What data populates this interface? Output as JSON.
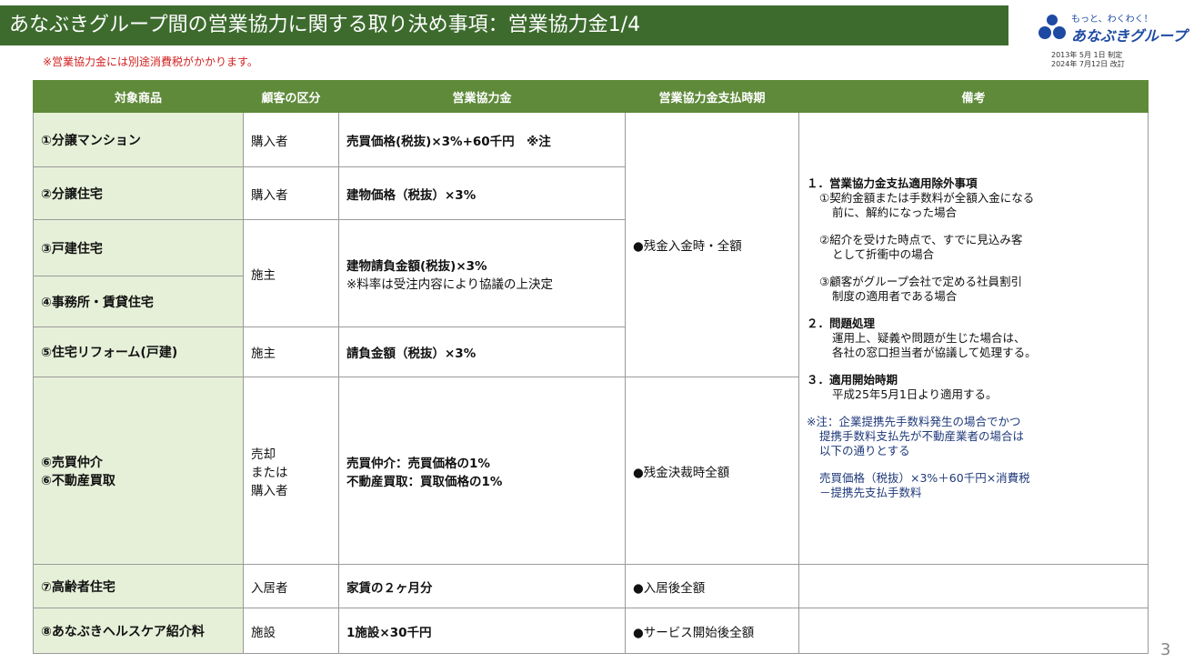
{
  "title": "あなぶきグループ間の営業協力に関する取り決め事項：営業協力金1/4",
  "tax_note": "※営業協力金には別途消費税がかかります。",
  "logo": {
    "tagline": "もっと、わくわく！",
    "name": "あなぶきグループ"
  },
  "dates": {
    "established": "2013年 5月 1日 制定",
    "revised": "2024年 7月12日 改訂"
  },
  "page_number": "3",
  "headers": {
    "product": "対象商品",
    "customer": "顧客の区分",
    "fee": "営業協力金",
    "timing": "営業協力金支払時期",
    "remarks": "備考"
  },
  "rows": {
    "r1": {
      "product": "①分譲マンション",
      "customer": "購入者",
      "fee": "売買価格(税抜)×3%+60千円　※注"
    },
    "r2": {
      "product": "②分譲住宅",
      "customer": "購入者",
      "fee": "建物価格（税抜）×3%"
    },
    "r3": {
      "product": "③戸建住宅"
    },
    "r4": {
      "product": "④事務所・賃貸住宅"
    },
    "r34": {
      "customer": "施主",
      "fee": "建物請負金額(税抜)×3%",
      "fee_note": "※料率は受注内容により協議の上決定"
    },
    "r5": {
      "product": "⑤住宅リフォーム(戸建)",
      "customer": "施主",
      "fee": "請負金額（税抜）×3%"
    },
    "r6": {
      "product_a": "⑥売買仲介",
      "product_b": "⑥不動産買取",
      "customer_a": "売却",
      "customer_b": "または",
      "customer_c": "購入者",
      "fee_a": "売買仲介：売買価格の1%",
      "fee_b": "不動産買取：買取価格の1%",
      "timing": "●残金決裁時全額"
    },
    "r7": {
      "product": "⑦高齢者住宅",
      "customer": "入居者",
      "fee": "家賃の２ヶ月分",
      "timing": "●入居後全額"
    },
    "r8": {
      "product": "⑧あなぶきヘルスケア紹介料",
      "customer": "施設",
      "fee": "1施設×30千円",
      "timing": "●サービス開始後全額"
    },
    "timing_top": "●残金入金時・全額"
  },
  "remarks": {
    "h1": "１．営業協力金支払適用除外事項",
    "i1a": "①契約金額または手数料が全額入金になる",
    "i1b": "前に、解約になった場合",
    "i2a": "②紹介を受けた時点で、すでに見込み客",
    "i2b": "として折衝中の場合",
    "i3a": "③顧客がグループ会社で定める社員割引",
    "i3b": "制度の適用者である場合",
    "h2": "２．問題処理",
    "p2a": "運用上、疑義や問題が生じた場合は、",
    "p2b": "各社の窓口担当者が協議して処理する。",
    "h3": "３．適用開始時期",
    "p3": "平成25年5月1日より適用する。",
    "n1": "※注：企業提携先手数料発生の場合でかつ",
    "n2": "提携手数料支払先が不動産業者の場合は",
    "n3": "以下の通りとする",
    "f1": "売買価格（税抜）×3%＋60千円×消費税",
    "f2": "－提携先支払手数料"
  },
  "colors": {
    "title_bg": "#3d6b2e",
    "header_bg": "#5f8a3a",
    "category_bg": "#e6f0d8",
    "note_red": "#d21f1f"
  }
}
